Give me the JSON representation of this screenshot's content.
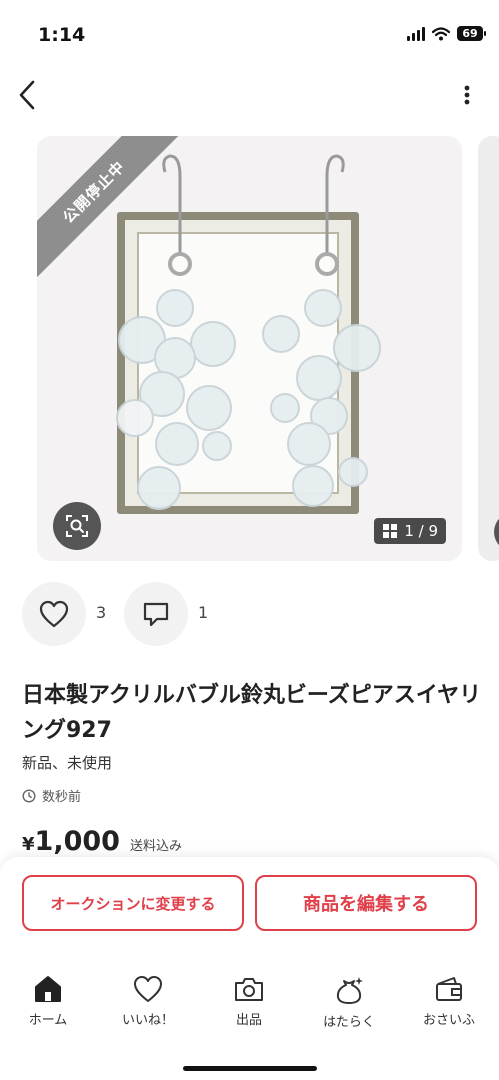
{
  "status_bar": {
    "time": "1:14",
    "battery": "69"
  },
  "listing": {
    "status_ribbon": "公開停止中",
    "image_counter": "1 / 9",
    "likes_count": "3",
    "comments_count": "1",
    "title": "日本製アクリルバブル鈴丸ビーズピアスイヤリング927",
    "condition": "新品、未使用",
    "posted_time": "数秒前",
    "price_symbol": "¥",
    "price_value": "1,000",
    "shipping_note": "送料込み"
  },
  "actions": {
    "auction_label": "オークションに変更する",
    "edit_label": "商品を編集する",
    "accent_color": "#e0404a"
  },
  "tabs": [
    {
      "label": "ホーム",
      "icon": "home-icon",
      "active": true
    },
    {
      "label": "いいね！",
      "icon": "heart-icon"
    },
    {
      "label": "出品",
      "icon": "camera-icon"
    },
    {
      "label": "はたらく",
      "icon": "money-bag-icon"
    },
    {
      "label": "おさいふ",
      "icon": "wallet-icon"
    }
  ]
}
